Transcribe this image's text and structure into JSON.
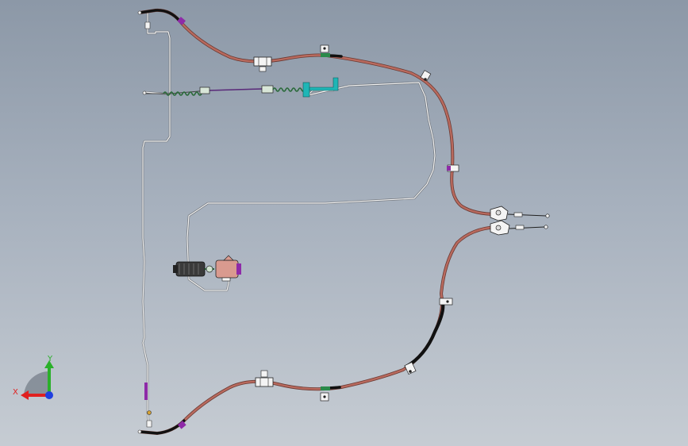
{
  "viewport": {
    "background_top": "#8c98a7",
    "background_bottom": "#c6ccd3"
  },
  "colors": {
    "cable_sheath": "#b96a5e",
    "cable_outline": "#6b3a33",
    "cable_black": "#111111",
    "tube_line": "#f2f2f2",
    "tube_shadow": "#4a4a4a",
    "clip_green": "#2a8a4a",
    "clip_purple": "#8e2aa8",
    "clip_cyan": "#1fb6b6",
    "clip_white": "#f4f4f4",
    "valve_body": "#d99a8f"
  },
  "triad": {
    "x_label": "X",
    "y_label": "Y",
    "x_color": "#e02020",
    "y_color": "#2ab02a",
    "z_color": "#1f3fe0"
  },
  "parts": [
    {
      "name": "upper-brake-cable",
      "kind": "cable"
    },
    {
      "name": "lower-brake-cable",
      "kind": "cable"
    },
    {
      "name": "brake-pipe-network",
      "kind": "pipe"
    },
    {
      "name": "hydraulic-control-unit",
      "kind": "valve"
    },
    {
      "name": "cable-equalizer-upper",
      "kind": "fitting"
    },
    {
      "name": "cable-equalizer-lower",
      "kind": "fitting"
    }
  ]
}
